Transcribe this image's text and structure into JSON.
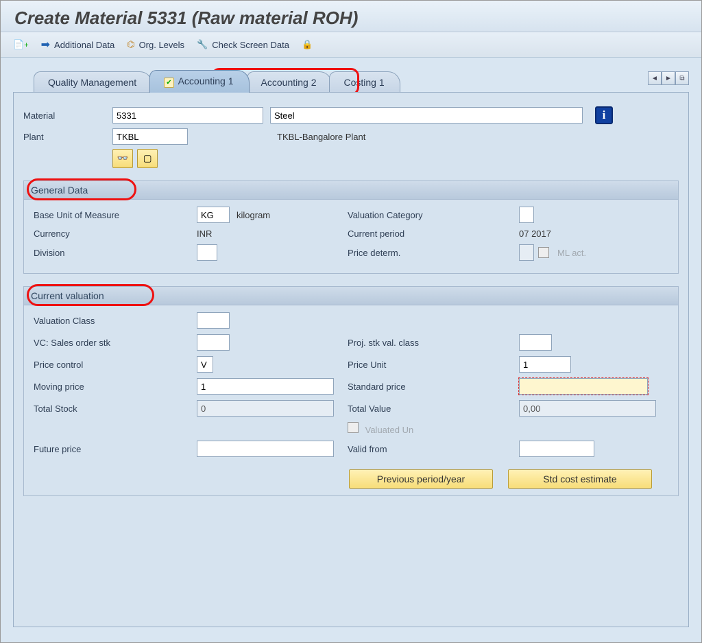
{
  "title": "Create Material 5331 (Raw material ROH)",
  "toolbar": {
    "additional_data": "Additional Data",
    "org_levels": "Org. Levels",
    "check_screen": "Check Screen Data"
  },
  "tabs": {
    "t1": "Quality Management",
    "t2": "Accounting 1",
    "t3": "Accounting 2",
    "t4": "Costing 1"
  },
  "header": {
    "material_label": "Material",
    "material_value": "5331",
    "material_desc": "Steel",
    "plant_label": "Plant",
    "plant_value": "TKBL",
    "plant_desc": "TKBL-Bangalore Plant"
  },
  "general": {
    "title": "General Data",
    "buom_label": "Base Unit of Measure",
    "buom_value": "KG",
    "buom_text": "kilogram",
    "valcat_label": "Valuation Category",
    "valcat_value": "",
    "currency_label": "Currency",
    "currency_value": "INR",
    "curper_label": "Current period",
    "curper_value": "07 2017",
    "division_label": "Division",
    "division_value": "",
    "pricedet_label": "Price determ.",
    "pricedet_value": "",
    "mlact_label": "ML act."
  },
  "valuation": {
    "title": "Current valuation",
    "valclass_label": "Valuation Class",
    "valclass_value": "",
    "vcsales_label": "VC: Sales order stk",
    "vcsales_value": "",
    "projstk_label": "Proj. stk val. class",
    "projstk_value": "",
    "pricecontrol_label": "Price control",
    "pricecontrol_value": "V",
    "priceunit_label": "Price Unit",
    "priceunit_value": "1",
    "movprice_label": "Moving price",
    "movprice_value": "1",
    "stdprice_label": "Standard price",
    "stdprice_value": "",
    "totstock_label": "Total Stock",
    "totstock_value": "0",
    "totvalue_label": "Total Value",
    "totvalue_value": "0,00",
    "valuated_label": "Valuated Un",
    "futprice_label": "Future price",
    "futprice_value": "",
    "validfrom_label": "Valid from",
    "validfrom_value": "",
    "prevperiod_btn": "Previous period/year",
    "stdcost_btn": "Std cost estimate"
  }
}
